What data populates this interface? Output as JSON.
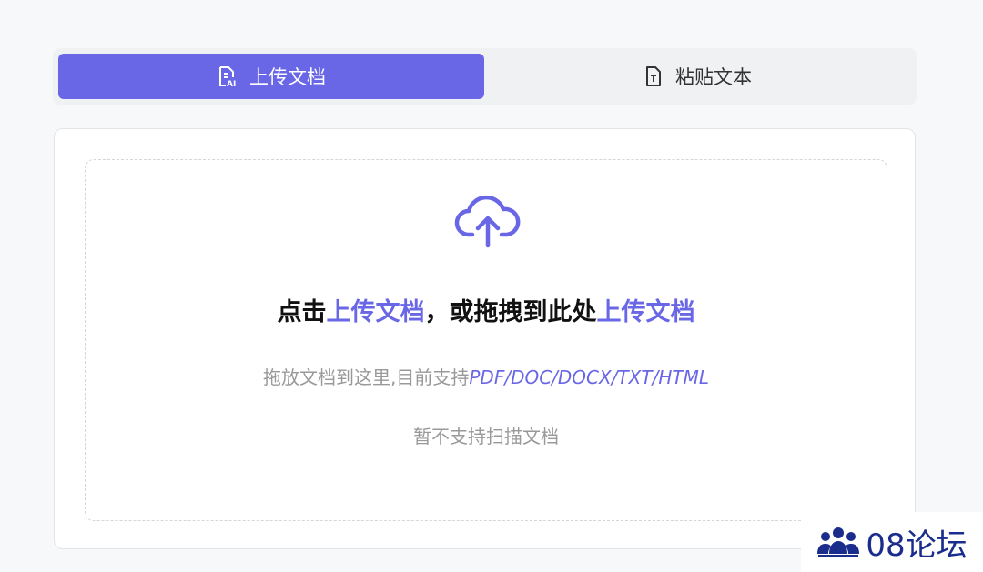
{
  "tabs": [
    {
      "label": "上传文档",
      "icon": "document-ai-icon",
      "active": true
    },
    {
      "label": "粘贴文本",
      "icon": "text-file-icon",
      "active": false
    }
  ],
  "upload": {
    "icon": "cloud-upload-icon",
    "headline_prefix": "点击",
    "headline_link1": "上传文档",
    "headline_middle": "，或拖拽到此处",
    "headline_link2": "上传文档",
    "formats_prefix": "拖放文档到这里,目前支持",
    "formats_list": "PDF/DOC/DOCX/TXT/HTML",
    "scan_note": "暂不支持扫描文档"
  },
  "watermark": {
    "text": "08论坛",
    "icon": "community-icon"
  },
  "colors": {
    "accent": "#6a67e6",
    "watermark": "#1a2c8c"
  }
}
